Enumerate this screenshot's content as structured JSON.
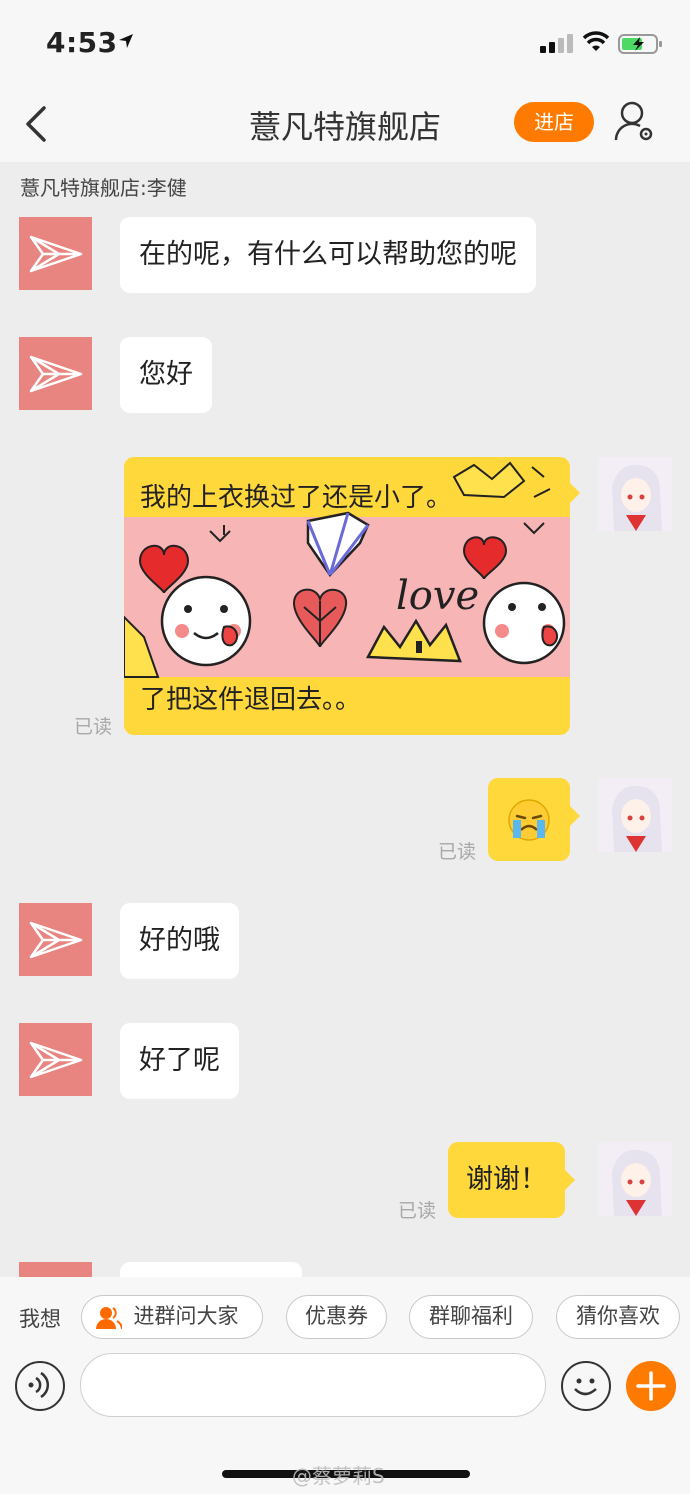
{
  "status_bar": {
    "time": "4:53"
  },
  "nav": {
    "title": "薏凡特旗舰店",
    "enter_label": "进店"
  },
  "shop_label": "薏凡特旗舰店:李健",
  "messages": {
    "m1": "在的呢，有什么可以帮助您的呢",
    "m2": "您好",
    "m3_line1": "我的上衣换过了还是小了。",
    "m3_line2": "了把这件退回去。。",
    "m3_read": "已读",
    "m4_read": "已读",
    "m5": "好的哦",
    "m6": "好了呢",
    "m7": "谢谢！",
    "m7_read": "已读"
  },
  "sticker": {
    "word": "love"
  },
  "quick_bar": {
    "label": "我想",
    "chips": [
      "进群问大家",
      "优惠券",
      "群聊福利",
      "猜你喜欢"
    ]
  },
  "input": {
    "placeholder": ""
  },
  "watermark": "@蔡萝莉S",
  "colors": {
    "accent": "#ff7a00",
    "bubble_me": "#ffd83c",
    "shop_avatar": "#e88580"
  }
}
